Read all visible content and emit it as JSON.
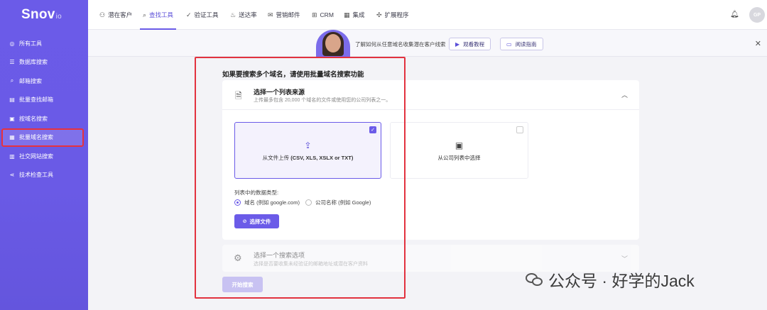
{
  "brand": {
    "name": "Snov",
    "suffix": "io"
  },
  "sidebar": {
    "items": [
      {
        "label": "所有工具",
        "icon": "globe-icon",
        "active": false
      },
      {
        "label": "数据库搜索",
        "icon": "database-icon",
        "active": false
      },
      {
        "label": "邮箱搜索",
        "icon": "email-search-icon",
        "active": false
      },
      {
        "label": "批量查找邮箱",
        "icon": "bulk-email-icon",
        "active": false
      },
      {
        "label": "按域名搜索",
        "icon": "domain-search-icon",
        "active": false
      },
      {
        "label": "批量域名搜索",
        "icon": "bulk-domain-icon",
        "active": true
      },
      {
        "label": "社交网站搜索",
        "icon": "social-icon",
        "active": false
      },
      {
        "label": "技术检查工具",
        "icon": "tech-icon",
        "active": false
      }
    ]
  },
  "topnav": {
    "items": [
      {
        "label": "潜在客户",
        "icon": "users-icon",
        "active": false
      },
      {
        "label": "查找工具",
        "icon": "search-icon",
        "active": true
      },
      {
        "label": "验证工具",
        "icon": "check-circle-icon",
        "active": false
      },
      {
        "label": "送达率",
        "icon": "flame-icon",
        "active": false
      },
      {
        "label": "营销邮件",
        "icon": "mail-icon",
        "active": false
      },
      {
        "label": "CRM",
        "icon": "crm-icon",
        "active": false
      },
      {
        "label": "集成",
        "icon": "grid-icon",
        "active": false
      },
      {
        "label": "扩展程序",
        "icon": "puzzle-icon",
        "active": false
      }
    ],
    "avatar_initials": "GP"
  },
  "banner": {
    "text": "了解如何从任意域名收集潜在客户线索",
    "watch_label": "观看教程",
    "read_label": "阅读指南"
  },
  "main": {
    "heading": "如果要搜索多个域名，请使用批量域名搜索功能",
    "source": {
      "title": "选择一个列表来源",
      "subtitle": "上传最多包含 20,000 个域名的文件或使用您的公司列表之一。",
      "upload_label": "从文件上传",
      "upload_formats": "(CSV, XLS, XSLX or TXT)",
      "company_list_label": "从公司列表中选择",
      "data_type_label": "列表中的数据类型:",
      "radio_domain": "域名 (例如 google.com)",
      "radio_company": "公司名称 (例如 Google)",
      "choose_file_label": "选择文件"
    },
    "search_option": {
      "title": "选择一个搜索选项",
      "subtitle": "选择是否要收集未经验证的邮箱地址或潜在客户资料"
    },
    "start_label": "开始搜索"
  },
  "watermark": {
    "text": "公众号 · 好学的Jack"
  },
  "colors": {
    "accent": "#6b5be8",
    "highlight": "#e2323f"
  }
}
